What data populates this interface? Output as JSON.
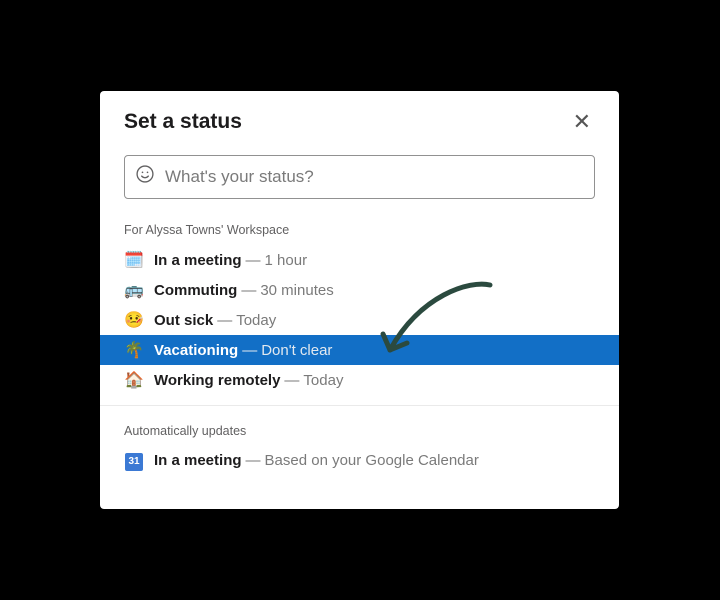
{
  "header": {
    "title": "Set a status",
    "close_label": "✕"
  },
  "input": {
    "placeholder": "What's your status?",
    "emoji_icon": "☺"
  },
  "workspace_section": {
    "label": "For Alyssa Towns' Workspace",
    "options": [
      {
        "emoji": "🗓️",
        "label": "In a meeting",
        "detail": "1 hour",
        "selected": false
      },
      {
        "emoji": "🚌",
        "label": "Commuting",
        "detail": "30 minutes",
        "selected": false
      },
      {
        "emoji": "🤒",
        "label": "Out sick",
        "detail": "Today",
        "selected": false
      },
      {
        "emoji": "🌴",
        "label": "Vacationing",
        "detail": "Don't clear",
        "selected": true
      },
      {
        "emoji": "🏠",
        "label": "Working remotely",
        "detail": "Today",
        "selected": false
      }
    ]
  },
  "auto_section": {
    "label": "Automatically updates",
    "options": [
      {
        "icon_text": "31",
        "label": "In a meeting",
        "detail": "Based on your Google Calendar"
      }
    ]
  },
  "dash": "—"
}
